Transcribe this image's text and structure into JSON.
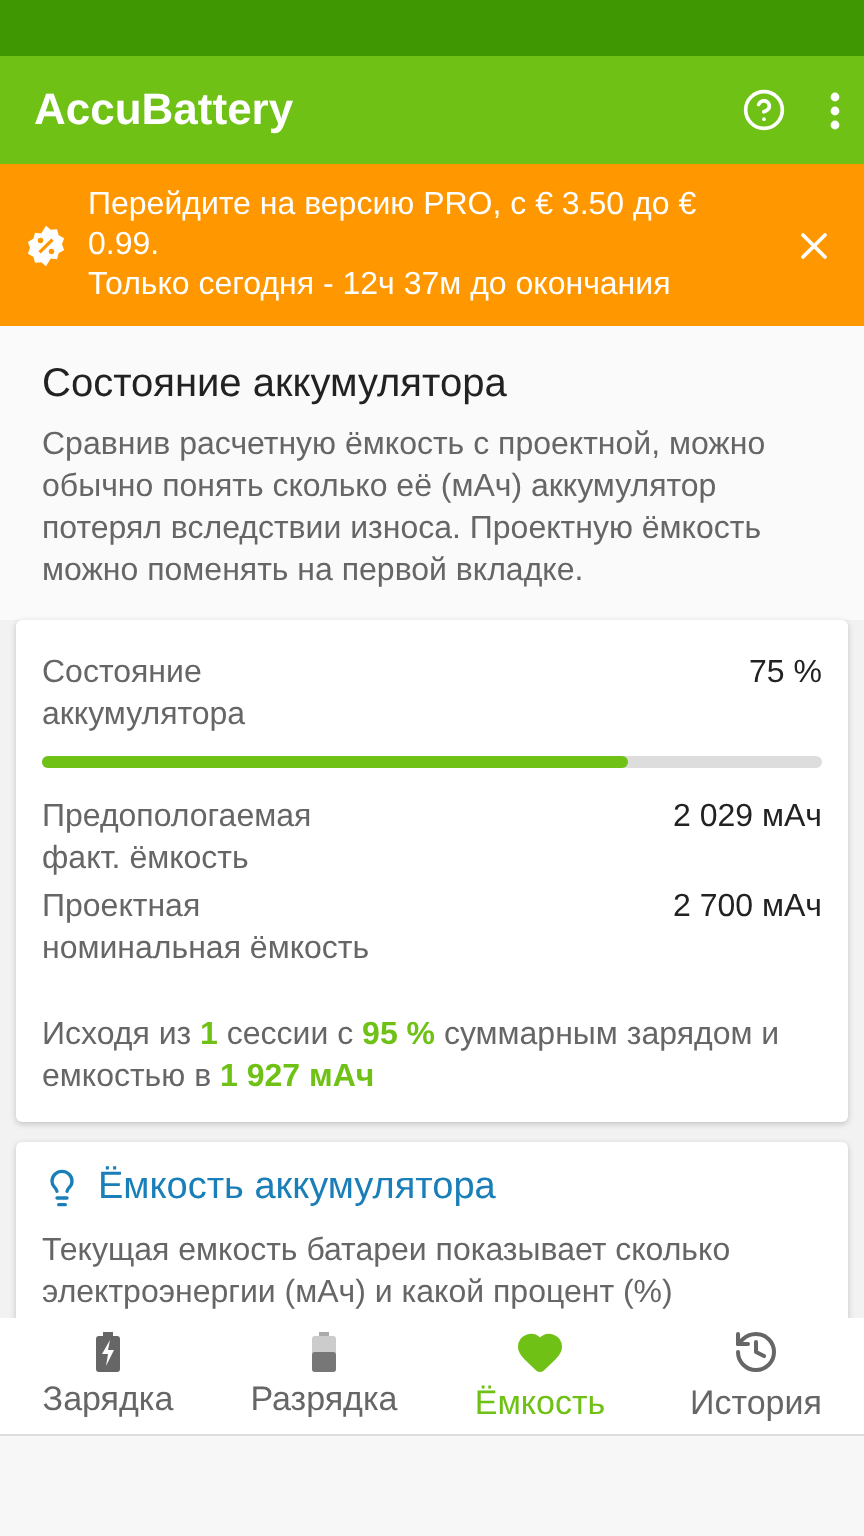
{
  "app_bar": {
    "title": "AccuBattery"
  },
  "promo": {
    "text": "Перейдите на версию PRO, с € 3.50 до € 0.99.",
    "countdown": "Только сегодня - 12ч 37м до окончания"
  },
  "section": {
    "title": "Состояние аккумулятора",
    "description": "Сравнив расчетную ёмкость с проектной, можно обычно понять сколько её (мАч) аккумулятор потерял вследствии износа. Проектную ёмкость можно поменять на первой вкладке."
  },
  "health_card": {
    "label": "Состояние аккумулятора",
    "value": "75 %",
    "level": 0.75,
    "rows": [
      {
        "label": "Предопологаемая факт. ёмкость",
        "value": "2 029 мАч"
      },
      {
        "label": "Проектная номинальная ёмкость",
        "value": "2 700 мАч"
      }
    ],
    "summary": "Исходя из **1** сессии с **95 %** суммарным зарядом и емкостью в **1 927 мАч**"
  },
  "tip_card": {
    "title": "Ёмкость аккумулятора",
    "text": "Текущая емкость батареи показывает сколько электроэнергии (мАч) и какой процент (%)"
  },
  "tabs": [
    {
      "kind": "charging",
      "label": "Зарядка",
      "selected": false
    },
    {
      "kind": "discharging",
      "label": "Разрядка",
      "selected": false
    },
    {
      "kind": "health",
      "label": "Ёмкость",
      "selected": true
    },
    {
      "kind": "history",
      "label": "История",
      "selected": false
    }
  ]
}
